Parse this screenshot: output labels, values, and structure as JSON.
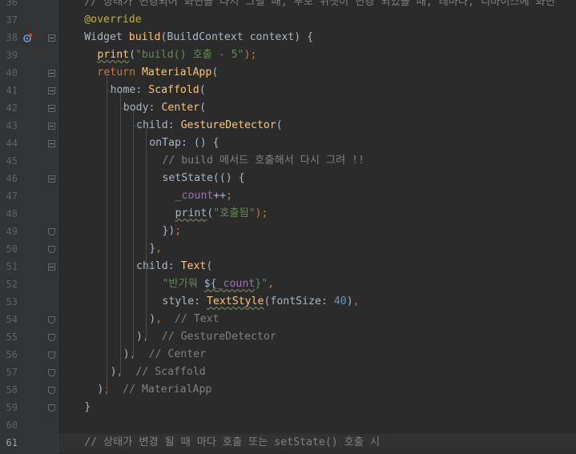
{
  "editor": {
    "gutter": {
      "line_numbers": [
        "36",
        "37",
        "38",
        "39",
        "40",
        "41",
        "42",
        "43",
        "44",
        "45",
        "46",
        "47",
        "48",
        "49",
        "50",
        "51",
        "52",
        "53",
        "54",
        "55",
        "56",
        "57",
        "58",
        "59",
        "60",
        "61"
      ],
      "current_line": "61",
      "override_marker_line": "38"
    },
    "lines": [
      {
        "n": "36",
        "indent": 1,
        "tokens": [
          {
            "t": "// 상태가 변경되어 화면을 다시 그릴 때, 부모 위젯이 변경 되었을 때, 테마나, 디바이스에 화면",
            "c": "com"
          }
        ]
      },
      {
        "n": "37",
        "indent": 1,
        "tokens": [
          {
            "t": "@override",
            "c": "ann"
          }
        ]
      },
      {
        "n": "38",
        "indent": 1,
        "tokens": [
          {
            "t": "Widget ",
            "c": "plain"
          },
          {
            "t": "build",
            "c": "fn"
          },
          {
            "t": "(BuildContext context) {",
            "c": "plain"
          }
        ]
      },
      {
        "n": "39",
        "indent": 2,
        "tokens": [
          {
            "t": "print",
            "c": "fn",
            "wavy": true
          },
          {
            "t": "(",
            "c": "plain"
          },
          {
            "t": "\"build() 호출 - 5\"",
            "c": "str"
          },
          {
            "t": ");",
            "c": "kw"
          }
        ]
      },
      {
        "n": "40",
        "indent": 2,
        "tokens": [
          {
            "t": "return ",
            "c": "kw"
          },
          {
            "t": "MaterialApp",
            "c": "fn"
          },
          {
            "t": "(",
            "c": "plain"
          }
        ]
      },
      {
        "n": "41",
        "indent": 3,
        "tokens": [
          {
            "t": "home: ",
            "c": "label"
          },
          {
            "t": "Scaffold",
            "c": "fn"
          },
          {
            "t": "(",
            "c": "plain"
          }
        ]
      },
      {
        "n": "42",
        "indent": 4,
        "tokens": [
          {
            "t": "body: ",
            "c": "label"
          },
          {
            "t": "Center",
            "c": "fn"
          },
          {
            "t": "(",
            "c": "plain"
          }
        ]
      },
      {
        "n": "43",
        "indent": 5,
        "tokens": [
          {
            "t": "child: ",
            "c": "label"
          },
          {
            "t": "GestureDetector",
            "c": "fn"
          },
          {
            "t": "(",
            "c": "plain"
          }
        ]
      },
      {
        "n": "44",
        "indent": 6,
        "tokens": [
          {
            "t": "onTap: () {",
            "c": "plain"
          }
        ]
      },
      {
        "n": "45",
        "indent": 7,
        "tokens": [
          {
            "t": "// build 메서드 호출해서 다시 그려 !!",
            "c": "com"
          }
        ]
      },
      {
        "n": "46",
        "indent": 7,
        "tokens": [
          {
            "t": "setState",
            "c": "plain"
          },
          {
            "t": "(() {",
            "c": "plain"
          }
        ]
      },
      {
        "n": "47",
        "indent": 8,
        "tokens": [
          {
            "t": "_count",
            "c": "field"
          },
          {
            "t": "++",
            "c": "plain"
          },
          {
            "t": ";",
            "c": "kw"
          }
        ]
      },
      {
        "n": "48",
        "indent": 8,
        "tokens": [
          {
            "t": "print",
            "c": "plain",
            "wavy": true
          },
          {
            "t": "(",
            "c": "plain"
          },
          {
            "t": "\"호출됨\"",
            "c": "str"
          },
          {
            "t": ");",
            "c": "kw"
          }
        ]
      },
      {
        "n": "49",
        "indent": 7,
        "tokens": [
          {
            "t": "})",
            "c": "plain"
          },
          {
            "t": ";",
            "c": "kw"
          }
        ]
      },
      {
        "n": "50",
        "indent": 6,
        "tokens": [
          {
            "t": "}",
            "c": "plain"
          },
          {
            "t": ",",
            "c": "kw"
          }
        ]
      },
      {
        "n": "51",
        "indent": 5,
        "tokens": [
          {
            "t": "child: ",
            "c": "label"
          },
          {
            "t": "Text",
            "c": "fn"
          },
          {
            "t": "(",
            "c": "plain"
          }
        ]
      },
      {
        "n": "52",
        "indent": 7,
        "tokens": [
          {
            "t": "\"반가워 ",
            "c": "str"
          },
          {
            "t": "${",
            "c": "plain",
            "wavy": true
          },
          {
            "t": "_count",
            "c": "field",
            "wavy": true
          },
          {
            "t": "}\"",
            "c": "str"
          },
          {
            "t": ",",
            "c": "kw"
          }
        ]
      },
      {
        "n": "53",
        "indent": 7,
        "tokens": [
          {
            "t": "style: ",
            "c": "label"
          },
          {
            "t": "TextStyle",
            "c": "fn",
            "wavy": true
          },
          {
            "t": "(fontSize: ",
            "c": "plain"
          },
          {
            "t": "40",
            "c": "num"
          },
          {
            "t": ")",
            "c": "plain"
          },
          {
            "t": ",",
            "c": "kw"
          }
        ]
      },
      {
        "n": "54",
        "indent": 6,
        "tokens": [
          {
            "t": ")",
            "c": "plain"
          },
          {
            "t": ",  ",
            "c": "kw"
          },
          {
            "t": "// Text",
            "c": "com"
          }
        ]
      },
      {
        "n": "55",
        "indent": 5,
        "tokens": [
          {
            "t": ")",
            "c": "plain"
          },
          {
            "t": ",  ",
            "c": "kw"
          },
          {
            "t": "// GestureDetector",
            "c": "com"
          }
        ]
      },
      {
        "n": "56",
        "indent": 4,
        "tokens": [
          {
            "t": ")",
            "c": "plain"
          },
          {
            "t": ",  ",
            "c": "kw"
          },
          {
            "t": "// Center",
            "c": "com"
          }
        ]
      },
      {
        "n": "57",
        "indent": 3,
        "tokens": [
          {
            "t": ")",
            "c": "plain"
          },
          {
            "t": ",  ",
            "c": "kw"
          },
          {
            "t": "// Scaffold",
            "c": "com"
          }
        ]
      },
      {
        "n": "58",
        "indent": 2,
        "tokens": [
          {
            "t": ")",
            "c": "plain"
          },
          {
            "t": ";  ",
            "c": "kw"
          },
          {
            "t": "// MaterialApp",
            "c": "com"
          }
        ]
      },
      {
        "n": "59",
        "indent": 1,
        "tokens": [
          {
            "t": "}",
            "c": "plain"
          }
        ]
      },
      {
        "n": "60",
        "indent": 0,
        "tokens": []
      },
      {
        "n": "61",
        "indent": 1,
        "tokens": [
          {
            "t": "// 상태가 변경 될 때 마다 호출 또는 setState() 호출 시",
            "c": "com"
          }
        ]
      }
    ],
    "fold_markers": {
      "38": "open",
      "40": "open",
      "41": "open",
      "42": "open",
      "43": "open",
      "44": "open",
      "46": "open",
      "49": "end",
      "50": "end",
      "51": "open",
      "54": "end",
      "55": "end",
      "56": "end",
      "57": "end",
      "58": "end",
      "59": "end"
    },
    "colors": {
      "background": "#2b2b2b",
      "gutter": "#313335",
      "keyword": "#cc7832",
      "function": "#ffc66d",
      "string": "#6a8759",
      "comment": "#808080",
      "number": "#6897bb",
      "annotation": "#bbb529",
      "field": "#9876aa"
    },
    "icons": {
      "override": "override-up-arrow-icon"
    }
  }
}
